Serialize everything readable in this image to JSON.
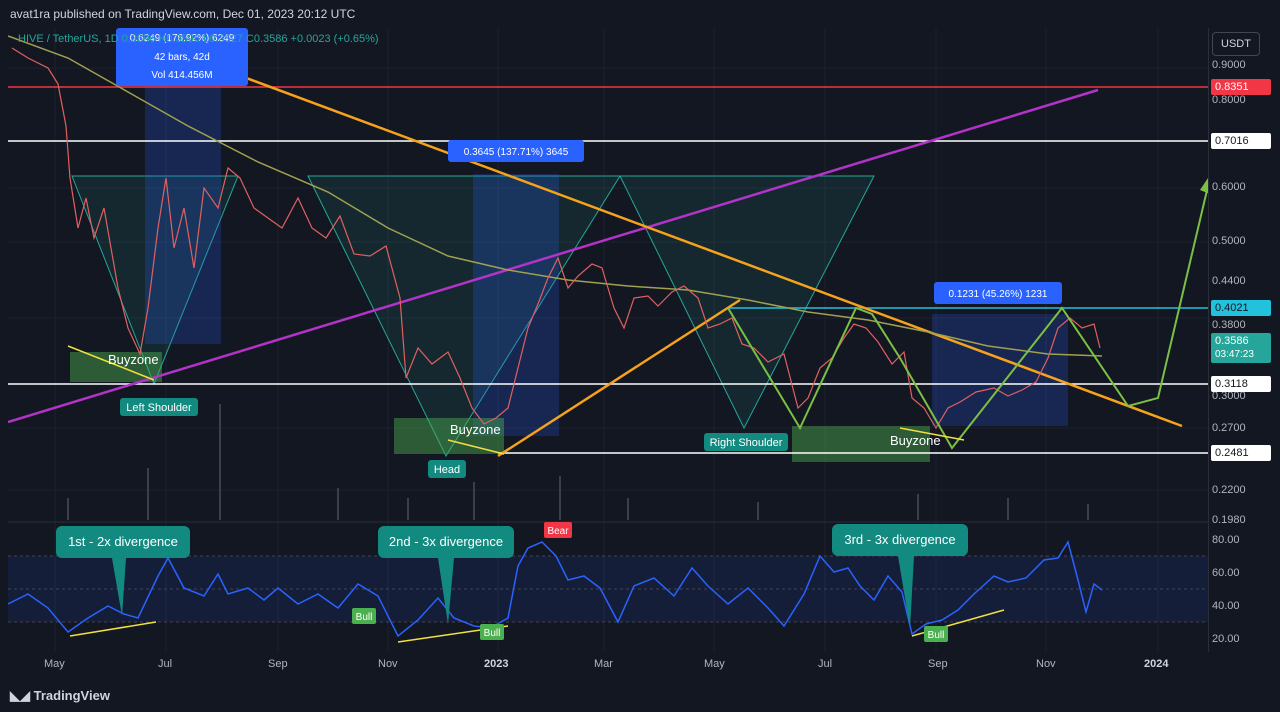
{
  "header": {
    "publisher": "avat1ra published on TradingView.com, Dec 01, 2023 20:12 UTC",
    "ohlc": "HIVE / TetherUS, 1D  0.3596  H0.3596  L0.3527  C0.3586  +0.0023 (+0.65%)"
  },
  "currency_button": "USDT",
  "price_axis": [
    "0.9000",
    "0.8000",
    "0.6000",
    "0.5000",
    "0.4400",
    "0.3800",
    "0.3000",
    "0.2700",
    "0.2200",
    "0.1980"
  ],
  "price_tags": {
    "red": "0.8351",
    "white1": "0.7016",
    "cyan": "0.4021",
    "current": "0.3586",
    "countdown": "03:47:23",
    "white2": "0.3118",
    "white3": "0.2481"
  },
  "rsi_axis": [
    "80.00",
    "60.00",
    "40.00",
    "20.00"
  ],
  "x_axis": [
    "May",
    "Jul",
    "Sep",
    "Nov",
    "2023",
    "Mar",
    "May",
    "Jul",
    "Sep",
    "Nov",
    "2024"
  ],
  "annotations": {
    "measure1_line1": "0.6249 (176.92%) 6249",
    "measure1_line2": "42 bars, 42d",
    "measure1_line3": "Vol 414.456M",
    "measure2": "0.3645 (137.71%) 3645",
    "measure3": "0.1231 (45.26%) 1231",
    "buyzone1": "Buyzone",
    "buyzone2": "Buyzone",
    "buyzone3": "Buyzone",
    "left_shoulder": "Left Shoulder",
    "head": "Head",
    "right_shoulder": "Right Shoulder",
    "div1": "1st - 2x divergence",
    "div2": "2nd - 3x divergence",
    "div3": "3rd - 3x divergence",
    "bull1": "Bull",
    "bull2": "Bull",
    "bull3": "Bull",
    "bear": "Bear"
  },
  "footer": {
    "logo": "TradingView"
  },
  "colors": {
    "background": "#131722",
    "red_line": "#f23645",
    "orange_line": "#f7a21b",
    "purple_line": "#b233c8",
    "green_line": "#7bc043",
    "rsi_line": "#2962ff",
    "cyan_line": "#22c1dc"
  }
}
